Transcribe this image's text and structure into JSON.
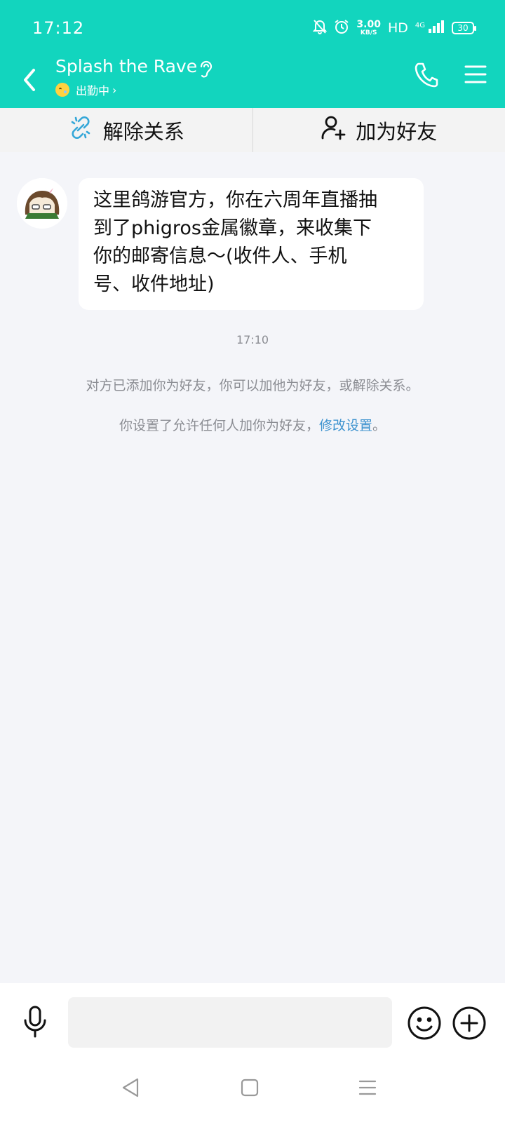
{
  "status_bar": {
    "time": "17:12",
    "speed_value": "3.00",
    "speed_unit": "KB/S",
    "hd": "HD",
    "network": "4G",
    "battery": "30",
    "icons": [
      "mute-bell-icon",
      "alarm-icon",
      "signal-icon",
      "battery-icon"
    ]
  },
  "header": {
    "title": "Splash the Rave",
    "status_text": "出勤中",
    "colors": {
      "accent": "#12d5be",
      "link": "#3e93cf"
    }
  },
  "actions": {
    "unbind_label": "解除关系",
    "add_friend_label": "加为好友"
  },
  "chat": {
    "message_lines": [
      "这里鸽游官方，你在六周年直播抽",
      "到了phigros金属徽章，来收集下",
      "你的邮寄信息～(收件人、手机",
      "号、收件地址)"
    ],
    "time": "17:10",
    "notice_1": "对方已添加你为好友，你可以加他为好友，或解除关系。",
    "notice_2_prefix": "你设置了允许任何人加你为好友，",
    "notice_2_link": "修改设置",
    "notice_2_suffix": "。"
  },
  "input": {
    "placeholder": ""
  }
}
